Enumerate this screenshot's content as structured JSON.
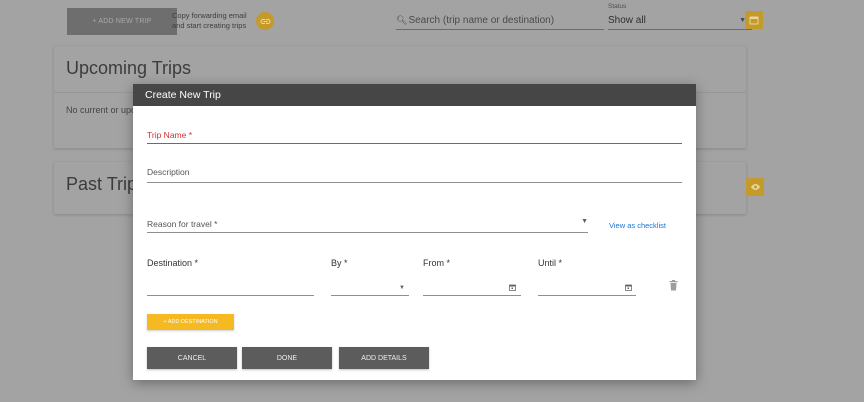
{
  "topbar": {
    "add_trip_label": "+ ADD NEW TRIP",
    "forward_line1": "Copy forwarding email",
    "forward_line2": "and start creating trips",
    "search_placeholder": "Search (trip name or destination)",
    "status_label": "Status",
    "status_value": "Show all"
  },
  "upcoming": {
    "title": "Upcoming Trips",
    "empty_text": "No current or upcoming trips"
  },
  "past": {
    "title": "Past Trips"
  },
  "modal": {
    "title": "Create New Trip",
    "trip_name_label": "Trip Name *",
    "description_label": "Description",
    "reason_label": "Reason for travel *",
    "checklist_link": "View as checklist",
    "destination_label": "Destination *",
    "by_label": "By *",
    "from_label": "From *",
    "until_label": "Until *",
    "add_destination_label": "+ ADD DESTINATION",
    "cancel_label": "CANCEL",
    "done_label": "DONE",
    "add_details_label": "ADD DETAILS"
  },
  "colors": {
    "accent": "#f5b922",
    "header": "#464646",
    "error": "#e53935",
    "link": "#1976d2"
  }
}
